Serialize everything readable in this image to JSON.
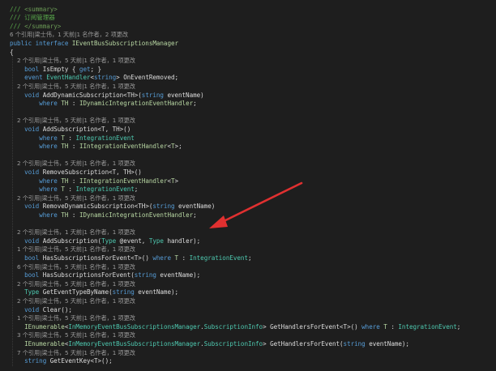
{
  "annotation": {
    "arrow_color": "#e03030"
  },
  "colors": {
    "background": "#1e1e1e",
    "comment": "#57a64a",
    "keyword": "#569cd6",
    "type": "#4ec9b0",
    "interface": "#b8d7a3",
    "text": "#dcdcdc",
    "codelens": "#9a9a9a"
  },
  "lines": [
    {
      "kind": "code",
      "tokens": [
        {
          "c": "cmt",
          "t": "/// "
        },
        {
          "c": "xml",
          "t": "<summary>"
        }
      ]
    },
    {
      "kind": "code",
      "tokens": [
        {
          "c": "cmt",
          "t": "/// 订阅管理器"
        }
      ]
    },
    {
      "kind": "code",
      "tokens": [
        {
          "c": "cmt",
          "t": "/// "
        },
        {
          "c": "xml",
          "t": "</summary>"
        }
      ]
    },
    {
      "kind": "meta",
      "text": "6 个引用|梁士伟，1 天前|1 名作者，2 项更改"
    },
    {
      "kind": "code",
      "tokens": [
        {
          "c": "kw",
          "t": "public interface "
        },
        {
          "c": "iface",
          "t": "IEventBusSubscriptionsManager"
        }
      ]
    },
    {
      "kind": "code",
      "tokens": [
        {
          "c": "id",
          "t": "{"
        }
      ]
    },
    {
      "kind": "meta",
      "text": "    2 个引用|梁士伟，5 天前|1 名作者，1 项更改"
    },
    {
      "kind": "code",
      "tokens": [
        {
          "c": "id",
          "t": "    "
        },
        {
          "c": "kw",
          "t": "bool "
        },
        {
          "c": "id",
          "t": "IsEmpty { "
        },
        {
          "c": "kw",
          "t": "get"
        },
        {
          "c": "id",
          "t": "; }"
        }
      ]
    },
    {
      "kind": "code",
      "tokens": [
        {
          "c": "id",
          "t": "    "
        },
        {
          "c": "kw",
          "t": "event "
        },
        {
          "c": "type",
          "t": "EventHandler"
        },
        {
          "c": "id",
          "t": "<"
        },
        {
          "c": "kw",
          "t": "string"
        },
        {
          "c": "id",
          "t": "> OnEventRemoved;"
        }
      ]
    },
    {
      "kind": "meta",
      "text": "    2 个引用|梁士伟，5 天前|1 名作者，1 项更改"
    },
    {
      "kind": "code",
      "tokens": [
        {
          "c": "id",
          "t": "    "
        },
        {
          "c": "kw",
          "t": "void "
        },
        {
          "c": "id",
          "t": "AddDynamicSubscription<TH>("
        },
        {
          "c": "kw",
          "t": "string "
        },
        {
          "c": "id",
          "t": "eventName)"
        }
      ]
    },
    {
      "kind": "code",
      "tokens": [
        {
          "c": "id",
          "t": "        "
        },
        {
          "c": "kw",
          "t": "where "
        },
        {
          "c": "iface",
          "t": "TH"
        },
        {
          "c": "id",
          "t": " : "
        },
        {
          "c": "iface",
          "t": "IDynamicIntegrationEventHandler"
        },
        {
          "c": "id",
          "t": ";"
        }
      ]
    },
    {
      "kind": "blank"
    },
    {
      "kind": "meta",
      "text": "    2 个引用|梁士伟，5 天前|1 名作者，1 项更改"
    },
    {
      "kind": "code",
      "tokens": [
        {
          "c": "id",
          "t": "    "
        },
        {
          "c": "kw",
          "t": "void "
        },
        {
          "c": "id",
          "t": "AddSubscription<T, TH>()"
        }
      ]
    },
    {
      "kind": "code",
      "tokens": [
        {
          "c": "id",
          "t": "        "
        },
        {
          "c": "kw",
          "t": "where "
        },
        {
          "c": "iface",
          "t": "T"
        },
        {
          "c": "id",
          "t": " : "
        },
        {
          "c": "type",
          "t": "IntegrationEvent"
        }
      ]
    },
    {
      "kind": "code",
      "tokens": [
        {
          "c": "id",
          "t": "        "
        },
        {
          "c": "kw",
          "t": "where "
        },
        {
          "c": "iface",
          "t": "TH"
        },
        {
          "c": "id",
          "t": " : "
        },
        {
          "c": "iface",
          "t": "IIntegrationEventHandler"
        },
        {
          "c": "id",
          "t": "<"
        },
        {
          "c": "iface",
          "t": "T"
        },
        {
          "c": "id",
          "t": ">;"
        }
      ]
    },
    {
      "kind": "blank"
    },
    {
      "kind": "meta",
      "text": "    2 个引用|梁士伟，5 天前|1 名作者，1 项更改"
    },
    {
      "kind": "code",
      "tokens": [
        {
          "c": "id",
          "t": "    "
        },
        {
          "c": "kw",
          "t": "void "
        },
        {
          "c": "id",
          "t": "RemoveSubscription<T, TH>()"
        }
      ]
    },
    {
      "kind": "code",
      "tokens": [
        {
          "c": "id",
          "t": "        "
        },
        {
          "c": "kw",
          "t": "where "
        },
        {
          "c": "iface",
          "t": "TH"
        },
        {
          "c": "id",
          "t": " : "
        },
        {
          "c": "iface",
          "t": "IIntegrationEventHandler"
        },
        {
          "c": "id",
          "t": "<"
        },
        {
          "c": "iface",
          "t": "T"
        },
        {
          "c": "id",
          "t": ">"
        }
      ]
    },
    {
      "kind": "code",
      "tokens": [
        {
          "c": "id",
          "t": "        "
        },
        {
          "c": "kw",
          "t": "where "
        },
        {
          "c": "iface",
          "t": "T"
        },
        {
          "c": "id",
          "t": " : "
        },
        {
          "c": "type",
          "t": "IntegrationEvent"
        },
        {
          "c": "id",
          "t": ";"
        }
      ]
    },
    {
      "kind": "meta",
      "text": "    2 个引用|梁士伟，5 天前|1 名作者，1 项更改"
    },
    {
      "kind": "code",
      "tokens": [
        {
          "c": "id",
          "t": "    "
        },
        {
          "c": "kw",
          "t": "void "
        },
        {
          "c": "id",
          "t": "RemoveDynamicSubscription<TH>("
        },
        {
          "c": "kw",
          "t": "string "
        },
        {
          "c": "id",
          "t": "eventName)"
        }
      ]
    },
    {
      "kind": "code",
      "tokens": [
        {
          "c": "id",
          "t": "        "
        },
        {
          "c": "kw",
          "t": "where "
        },
        {
          "c": "iface",
          "t": "TH"
        },
        {
          "c": "id",
          "t": " : "
        },
        {
          "c": "iface",
          "t": "IDynamicIntegrationEventHandler"
        },
        {
          "c": "id",
          "t": ";"
        }
      ]
    },
    {
      "kind": "blank"
    },
    {
      "kind": "meta",
      "text": "    2 个引用|梁士伟，1 天前|1 名作者，1 项更改"
    },
    {
      "kind": "code",
      "tokens": [
        {
          "c": "id",
          "t": "    "
        },
        {
          "c": "kw",
          "t": "void "
        },
        {
          "c": "id",
          "t": "AddSubscription("
        },
        {
          "c": "type",
          "t": "Type"
        },
        {
          "c": "id",
          "t": " @event, "
        },
        {
          "c": "type",
          "t": "Type"
        },
        {
          "c": "id",
          "t": " handler);"
        }
      ]
    },
    {
      "kind": "meta",
      "text": "    1 个引用|梁士伟，5 天前|1 名作者，1 项更改"
    },
    {
      "kind": "code",
      "tokens": [
        {
          "c": "id",
          "t": "    "
        },
        {
          "c": "kw",
          "t": "bool "
        },
        {
          "c": "id",
          "t": "HasSubscriptionsForEvent<T>() "
        },
        {
          "c": "kw",
          "t": "where "
        },
        {
          "c": "iface",
          "t": "T"
        },
        {
          "c": "id",
          "t": " : "
        },
        {
          "c": "type",
          "t": "IntegrationEvent"
        },
        {
          "c": "id",
          "t": ";"
        }
      ]
    },
    {
      "kind": "meta",
      "text": "    6 个引用|梁士伟，5 天前|1 名作者，1 项更改"
    },
    {
      "kind": "code",
      "tokens": [
        {
          "c": "id",
          "t": "    "
        },
        {
          "c": "kw",
          "t": "bool "
        },
        {
          "c": "id",
          "t": "HasSubscriptionsForEvent("
        },
        {
          "c": "kw",
          "t": "string "
        },
        {
          "c": "id",
          "t": "eventName);"
        }
      ]
    },
    {
      "kind": "meta",
      "text": "    2 个引用|梁士伟，5 天前|1 名作者，1 项更改"
    },
    {
      "kind": "code",
      "tokens": [
        {
          "c": "id",
          "t": "    "
        },
        {
          "c": "type",
          "t": "Type"
        },
        {
          "c": "id",
          "t": " GetEventTypeByName("
        },
        {
          "c": "kw",
          "t": "string "
        },
        {
          "c": "id",
          "t": "eventName);"
        }
      ]
    },
    {
      "kind": "meta",
      "text": "    2 个引用|梁士伟，5 天前|1 名作者，1 项更改"
    },
    {
      "kind": "code",
      "tokens": [
        {
          "c": "id",
          "t": "    "
        },
        {
          "c": "kw",
          "t": "void "
        },
        {
          "c": "id",
          "t": "Clear();"
        }
      ]
    },
    {
      "kind": "meta",
      "text": "    1 个引用|梁士伟，5 天前|1 名作者，1 项更改"
    },
    {
      "kind": "code",
      "tokens": [
        {
          "c": "id",
          "t": "    "
        },
        {
          "c": "iface",
          "t": "IEnumerable"
        },
        {
          "c": "id",
          "t": "<"
        },
        {
          "c": "type",
          "t": "InMemoryEventBusSubscriptionsManager"
        },
        {
          "c": "id",
          "t": "."
        },
        {
          "c": "type",
          "t": "SubscriptionInfo"
        },
        {
          "c": "id",
          "t": "> GetHandlersForEvent<T>() "
        },
        {
          "c": "kw",
          "t": "where "
        },
        {
          "c": "iface",
          "t": "T"
        },
        {
          "c": "id",
          "t": " : "
        },
        {
          "c": "type",
          "t": "IntegrationEvent"
        },
        {
          "c": "id",
          "t": ";"
        }
      ]
    },
    {
      "kind": "meta",
      "text": "    3 个引用|梁士伟，5 天前|1 名作者，1 项更改"
    },
    {
      "kind": "code",
      "tokens": [
        {
          "c": "id",
          "t": "    "
        },
        {
          "c": "iface",
          "t": "IEnumerable"
        },
        {
          "c": "id",
          "t": "<"
        },
        {
          "c": "type",
          "t": "InMemoryEventBusSubscriptionsManager"
        },
        {
          "c": "id",
          "t": "."
        },
        {
          "c": "type",
          "t": "SubscriptionInfo"
        },
        {
          "c": "id",
          "t": "> GetHandlersForEvent("
        },
        {
          "c": "kw",
          "t": "string "
        },
        {
          "c": "id",
          "t": "eventName);"
        }
      ]
    },
    {
      "kind": "meta",
      "text": "    7 个引用|梁士伟，5 天前|1 名作者，1 项更改"
    },
    {
      "kind": "code",
      "tokens": [
        {
          "c": "id",
          "t": "    "
        },
        {
          "c": "kw",
          "t": "string "
        },
        {
          "c": "id",
          "t": "GetEventKey<T>();"
        }
      ]
    }
  ]
}
